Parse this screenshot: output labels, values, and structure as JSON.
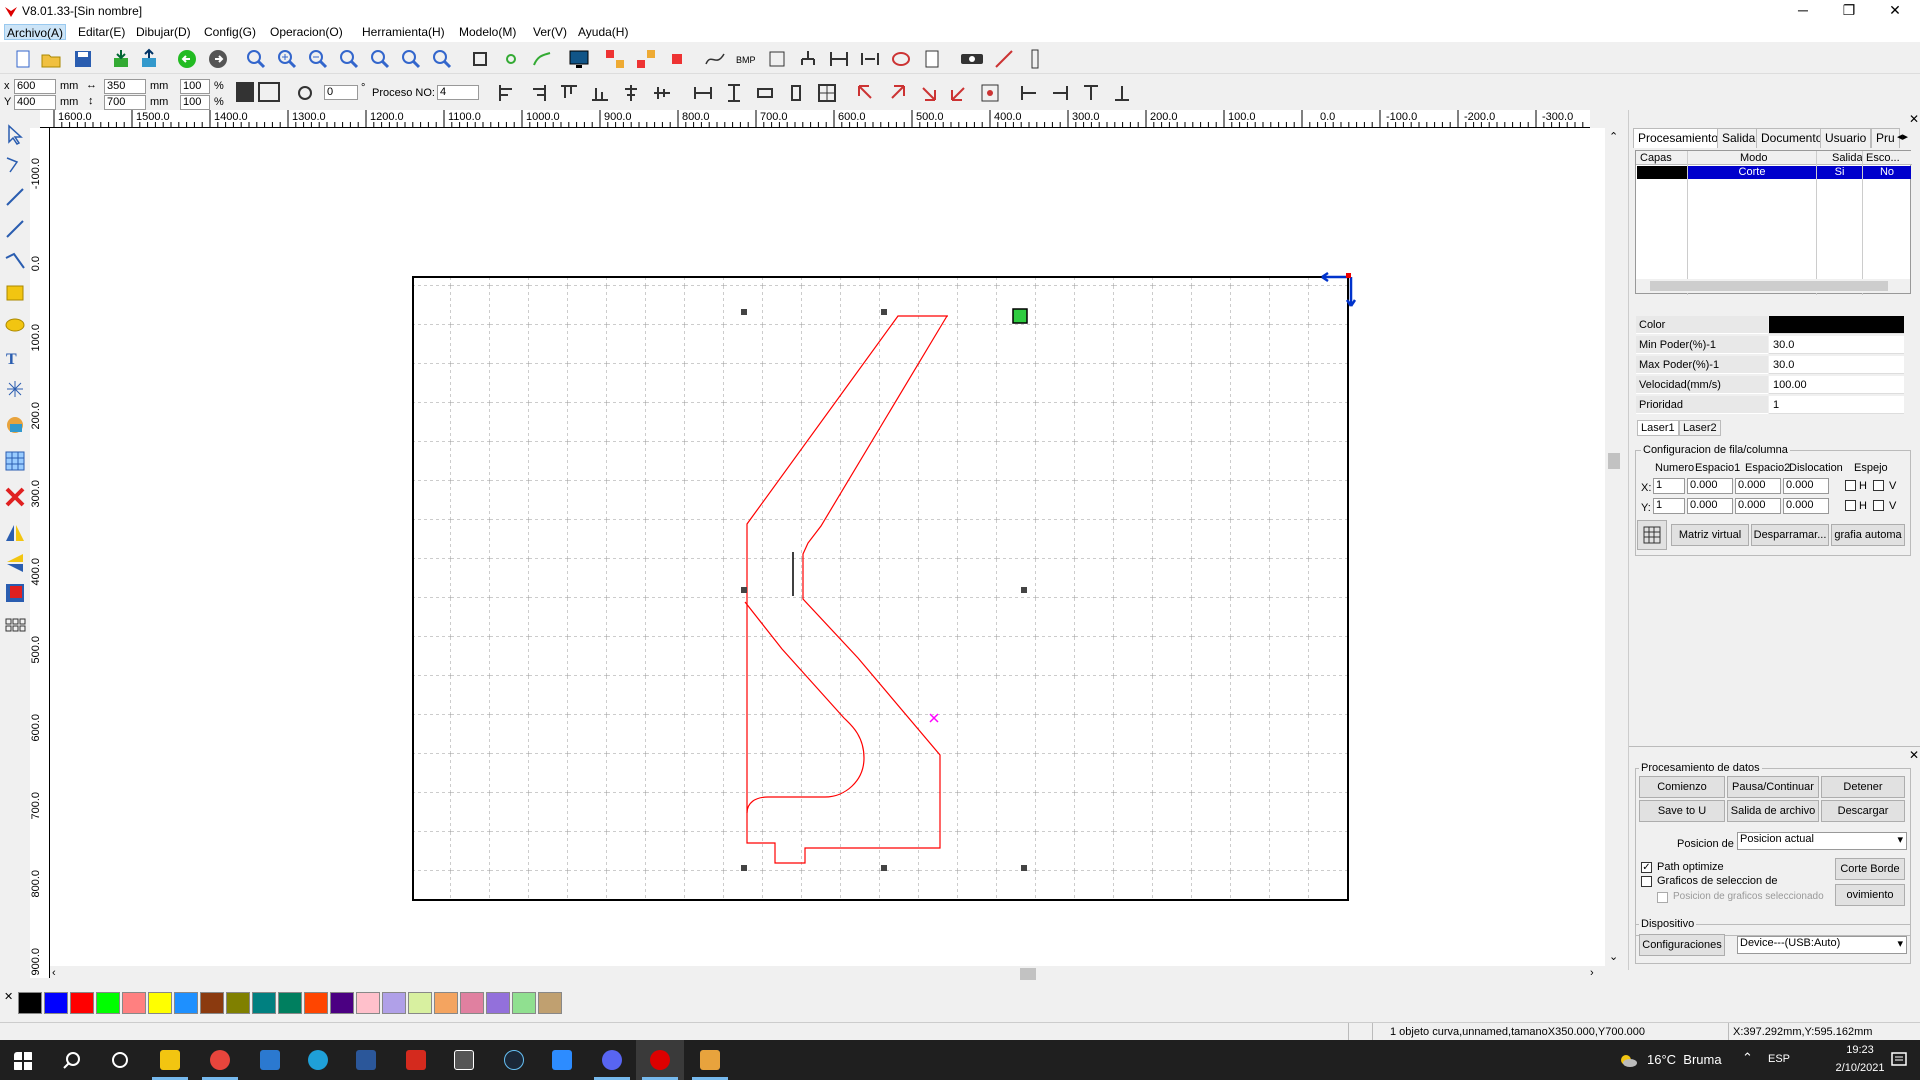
{
  "window": {
    "title": "V8.01.33-[Sin nombre]",
    "controls": [
      "─",
      "❐",
      "✕"
    ]
  },
  "menu": [
    "Archivo(A)",
    "Editar(E)",
    "Dibujar(D)",
    "Config(G)",
    "Operacion(O)",
    "Herramienta(H)",
    "Modelo(M)",
    "Ver(V)",
    "Ayuda(H)"
  ],
  "params": {
    "x_label": "x",
    "y_label": "Y",
    "x_value": "600",
    "y_value": "400",
    "w_value": "350",
    "h_value": "700",
    "unit": "mm",
    "scale_x": "100",
    "scale_y": "100",
    "pct": "%",
    "angle": "0",
    "deg": "°",
    "process_label": "Proceso NO:",
    "process_value": "4"
  },
  "ruler_top": [
    "1600.0",
    "1500.0",
    "1400.0",
    "1300.0",
    "1200.0",
    "1100.0",
    "1000.0",
    "900.0",
    "800.0",
    "700.0",
    "600.0",
    "500.0",
    "400.0",
    "300.0",
    "200.0",
    "100.0",
    "0.0",
    "-100.0",
    "-200.0",
    "-300.0"
  ],
  "ruler_left": [
    "-100.0",
    "0.0",
    "100.0",
    "200.0",
    "300.0",
    "400.0",
    "500.0",
    "600.0",
    "700.0",
    "800.0",
    "900.0"
  ],
  "panel": {
    "tabs": [
      "Procesamiento",
      "Salida",
      "Documento",
      "Usuario",
      "Pru"
    ],
    "layer_headers": [
      "Capas",
      "Modo",
      "Salida",
      "Esco..."
    ],
    "layer_row": {
      "mode": "Corte",
      "output": "Si",
      "hide": "No",
      "color": "#000000"
    },
    "props": [
      {
        "name": "Color",
        "value": ""
      },
      {
        "name": "Min Poder(%)-1",
        "value": "30.0"
      },
      {
        "name": "Max Poder(%)-1",
        "value": "30.0"
      },
      {
        "name": "Velocidad(mm/s)",
        "value": "100.00"
      },
      {
        "name": "Prioridad",
        "value": "1"
      }
    ],
    "laser_tabs": [
      "Laser1",
      "Laser2"
    ],
    "array_title": "Configuracion de fila/columna",
    "array_headers": [
      "Numero",
      "Espacio1",
      "Espacio2",
      "Dislocation",
      "Espejo"
    ],
    "array_x": {
      "label": "X:",
      "num": "1",
      "e1": "0.000",
      "e2": "0.000",
      "d": "0.000",
      "h": "H",
      "v": "V"
    },
    "array_y": {
      "label": "Y:",
      "num": "1",
      "e1": "0.000",
      "e2": "0.000",
      "d": "0.000",
      "h": "H",
      "v": "V"
    },
    "array_buttons": [
      "Matriz virtual",
      "Desparramar...",
      "grafia automa"
    ],
    "data_title": "Procesamiento de datos",
    "data_buttons": [
      "Comienzo",
      "Pausa/Continuar",
      "Detener",
      "Save to U Archivo",
      "Salida de archivo U",
      "Descargar"
    ],
    "position_label": "Posicion de",
    "position_value": "Posicion actual",
    "path_optimize": "Path optimize",
    "graficos": "Graficos de seleccion de",
    "pos_graficos": "Posicion de graficos seleccionado",
    "corte_borde": "Corte Borde",
    "movimiento": "ovimiento Bord",
    "device_title": "Dispositivo",
    "config_button": "Configuraciones",
    "device_value": "Device---(USB:Auto)"
  },
  "palette": [
    "#000000",
    "#0000ff",
    "#ff0000",
    "#00ff00",
    "#ff8080",
    "#ffff00",
    "#1e90ff",
    "#8b3a0f",
    "#808000",
    "#008080",
    "#007f5f",
    "#ff4500",
    "#4b0082",
    "#ffc0cb",
    "#b0a0e8",
    "#d8f0a0",
    "#f4a460",
    "#e080a0",
    "#9370db",
    "#90e090",
    "#c0a070"
  ],
  "status": {
    "info": "1 objeto curva,unnamed,tamanoX350.000,Y700.000",
    "coords": "X:397.292mm,Y:595.162mm"
  },
  "taskbar": {
    "weather": "16°C  Bruma",
    "lang": "ESP",
    "time": "19:23",
    "date": "2/10/2021"
  },
  "colors": {
    "cut_line": "#ff0000",
    "selection_handle": "#333333",
    "layer_highlight": "#0000cc"
  }
}
